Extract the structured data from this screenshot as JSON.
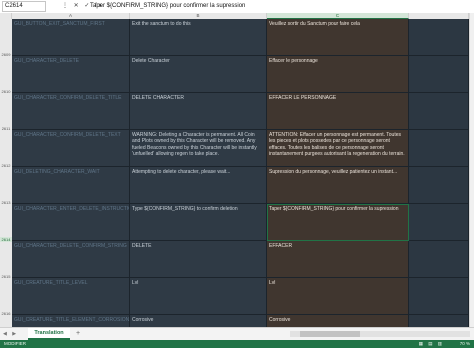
{
  "formula_bar": {
    "name_box": "C2614",
    "icons": "⋮ ✕ ✓ fx",
    "content": "Taper ${CONFIRM_STRING} pour confirmer la supression"
  },
  "columns": {
    "corner": "",
    "a": "A",
    "b": "B",
    "c": "C",
    "d": ""
  },
  "rows": [
    {
      "num": "2609",
      "a": "GUI_BUTTON_EXIT_SANCTUM_FIRST",
      "b": "Exit the sanctum to do this",
      "c": "Veuillez sortir du Sanctum pour faire cela"
    },
    {
      "num": "2610",
      "a": "GUI_CHARACTER_DELETE",
      "b": "Delete Character",
      "c": "Effacer le personnage"
    },
    {
      "num": "2611",
      "a": "GUI_CHARACTER_CONFIRM_DELETE_TITLE",
      "b": "DELETE CHARACTER",
      "c": "EFFACER LE PERSONNAGE"
    },
    {
      "num": "2612",
      "a": "GUI_CHARACTER_CONFIRM_DELETE_TEXT",
      "b": "WARNING: Deleting a Character is permanent. All Coin and Plots owned by this Character will be removed. Any fueled Beacons owned by this Character will be instantly 'unfuelled' allowing regen to take place.",
      "c": "ATTENTION: Effacer un personnage est permanent. Toutes les pieces et plots possedes par ce personnage seront effaces. Toutes les balises de ce personnage seront instantanement purgees autorisant la regeneration du terrain."
    },
    {
      "num": "2613",
      "a": "GUI_DELETING_CHARACTER_WAIT",
      "b": "Attempting to delete character, please wait...",
      "c": "Supression du personnage, veuillez patientez un instant..."
    },
    {
      "num": "2614",
      "a": "GUI_CHARACTER_ENTER_DELETE_INSTRUCTIONS",
      "b": "Type ${CONFIRM_STRING} to confirm deletion",
      "c": "Taper ${CONFIRM_STRING} pour confirmer la supression"
    },
    {
      "num": "2615",
      "a": "GUI_CHARACTER_DELETE_CONFIRM_STRING",
      "b": "DELETE",
      "c": "EFFACER"
    },
    {
      "num": "2616",
      "a": "GUI_CREATURE_TITLE_LEVEL",
      "b": "Lvl",
      "c": "Lvl"
    },
    {
      "num": "",
      "a": "GUI_CREATURE_TITLE_ELEMENT_CORROSION",
      "b": "Corrosive",
      "c": "Corrosive"
    }
  ],
  "sheet_tabs": {
    "nav": "◀ ▶",
    "active": "Translation",
    "add": "+"
  },
  "status_bar": {
    "mode": "MODIFIER",
    "views": "▦ ▤ ▥",
    "zoom": "70 %"
  },
  "colors": {
    "excel_green": "#217346",
    "grid_bg": "#2c3540",
    "col_c_bg": "#40362f"
  }
}
